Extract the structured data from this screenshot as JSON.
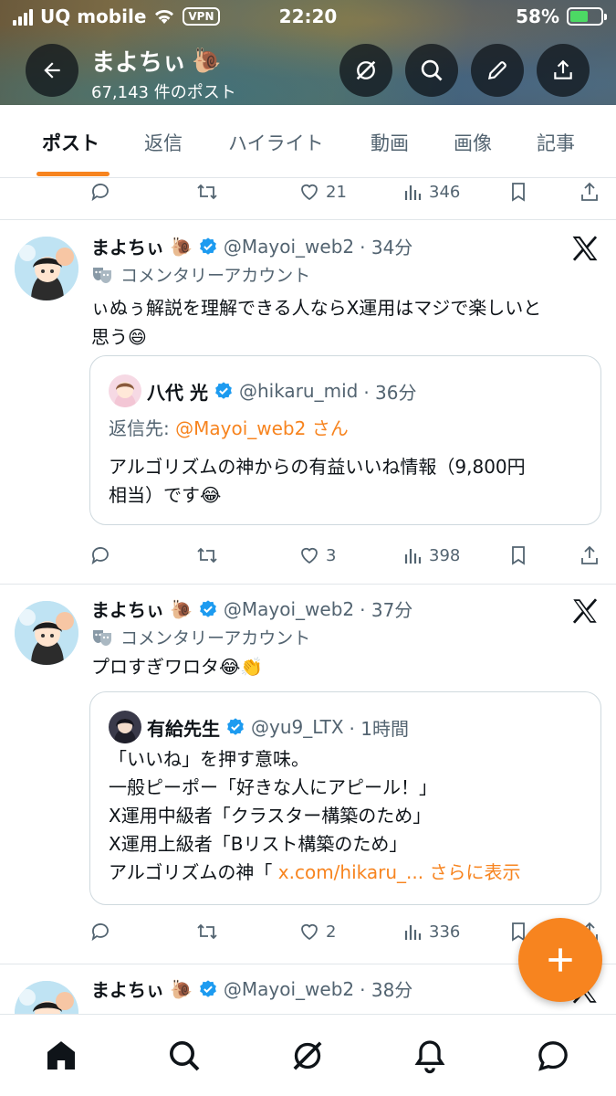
{
  "status_bar": {
    "carrier": "UQ mobile",
    "vpn": "VPN",
    "time": "22:20",
    "battery": "58%",
    "battery_level": 0.58
  },
  "header": {
    "name": "まよちぃ",
    "post_count": "67,143 件のポスト"
  },
  "tabs": [
    "ポスト",
    "返信",
    "ハイライト",
    "動画",
    "画像",
    "記事"
  ],
  "top_actions": {
    "likes": "21",
    "views": "346"
  },
  "tweets": [
    {
      "display_name": "まよちぃ",
      "handle": "@Mayoi_web2",
      "time": "· 34分",
      "label": "コメンタリーアカウント",
      "text_lines": [
        "ぃぬぅ解説を理解できる人ならX運用はマジで楽しいと",
        "思う"
      ],
      "quote": {
        "display_name": "八代 光",
        "handle": "@hikaru_mid",
        "time": "· 36分",
        "reply_prefix": "返信先:",
        "reply_to": "@Mayoi_web2 さん",
        "text_lines": [
          "アルゴリズムの神からの有益いいね情報（9,800円",
          "相当）です"
        ]
      },
      "likes": "3",
      "views": "398"
    },
    {
      "display_name": "まよちぃ",
      "handle": "@Mayoi_web2",
      "time": "· 37分",
      "label": "コメンタリーアカウント",
      "text_lines": [
        "プロすぎワロタ"
      ],
      "quote": {
        "display_name": "有給先生",
        "handle": "@yu9_LTX",
        "time": "· 1時間",
        "text_lines": [
          "「いいね」を押す意味。",
          "一般ピーポー「好きな人にアピール！」",
          "X運用中級者「クラスター構築のため」",
          "X運用上級者「Bリスト構築のため」",
          "アルゴリズムの神「"
        ],
        "link": "x.com/hikaru_...",
        "more": "さらに表示"
      },
      "likes": "2",
      "views": "336"
    },
    {
      "display_name": "まよちぃ",
      "handle": "@Mayoi_web2",
      "time": "· 38分"
    }
  ],
  "emoji": {
    "snail": "🐌",
    "grin": "😄",
    "joy": "😂",
    "clap": "👏"
  },
  "colors": {
    "accent": "#f7841f",
    "verified": "#1d9bf0",
    "muted": "#536471",
    "text": "#0f1419"
  }
}
